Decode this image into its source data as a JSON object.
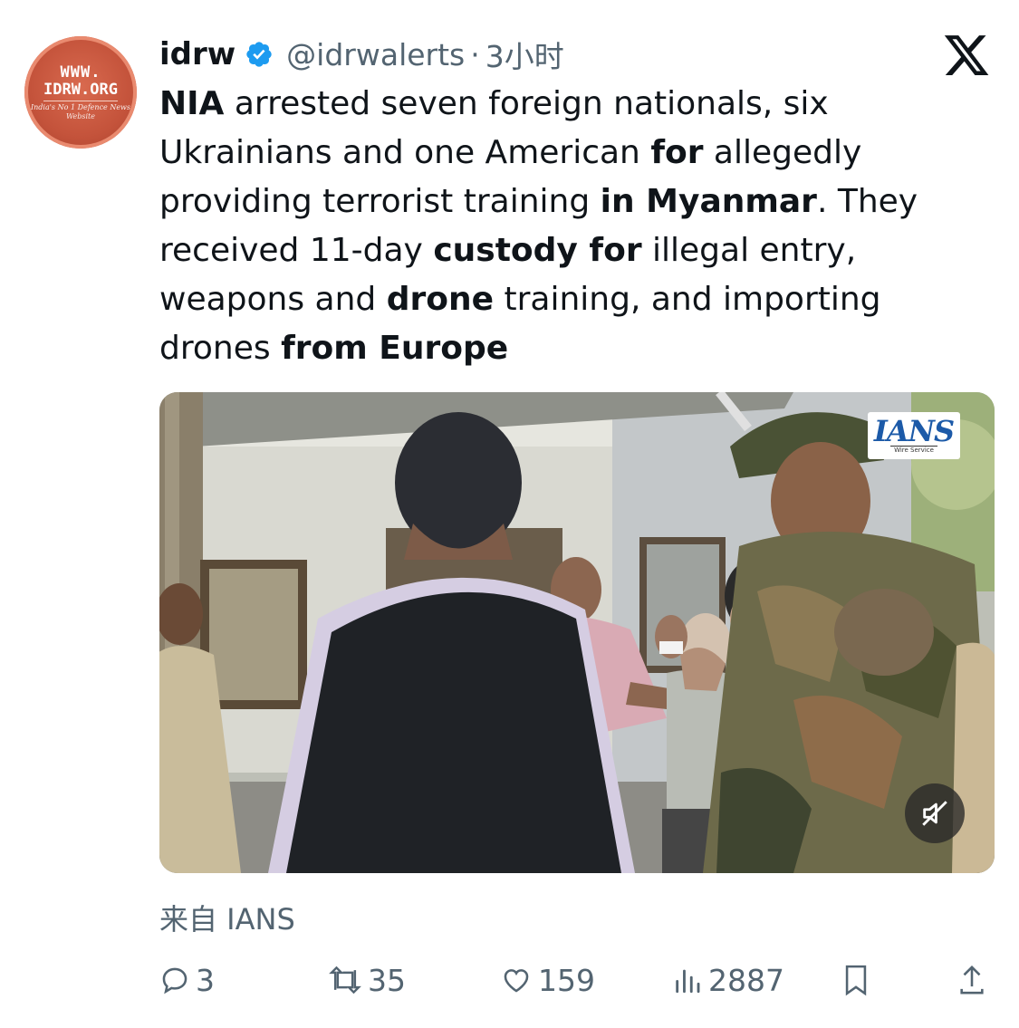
{
  "account": {
    "name": "idrw",
    "handle": "@idrwalerts",
    "separator": "·",
    "time": "3小时",
    "avatar_lines": [
      "WWW.",
      "IDRW.ORG",
      "India's No 1 Defence News",
      "Website"
    ]
  },
  "tweet": {
    "segments": [
      {
        "text": "NIA",
        "bold": true
      },
      {
        "text": " arrested seven foreign nationals, six Ukrainians and one American ",
        "bold": false
      },
      {
        "text": "for",
        "bold": true
      },
      {
        "text": " allegedly providing terrorist training ",
        "bold": false
      },
      {
        "text": "in Myanmar",
        "bold": true
      },
      {
        "text": ". They received 11-day ",
        "bold": false
      },
      {
        "text": "custody for",
        "bold": true
      },
      {
        "text": " illegal entry, weapons and ",
        "bold": false
      },
      {
        "text": "drone",
        "bold": true
      },
      {
        "text": " training, and importing drones ",
        "bold": false
      },
      {
        "text": "from Europe",
        "bold": true
      }
    ]
  },
  "media": {
    "watermark": "IANS",
    "watermark_sub": "Wire Service"
  },
  "source_label": "来自 IANS",
  "actions": {
    "replies": "3",
    "reposts": "35",
    "likes": "159",
    "views": "2887"
  },
  "colors": {
    "text": "#0f1419",
    "secondary": "#536471",
    "verified": "#1d9bf0",
    "avatar": "#c4533b"
  },
  "icons": [
    "verified-badge-icon",
    "x-logo-icon",
    "mute-icon",
    "reply-icon",
    "repost-icon",
    "like-icon",
    "views-icon",
    "bookmark-icon",
    "share-icon"
  ]
}
